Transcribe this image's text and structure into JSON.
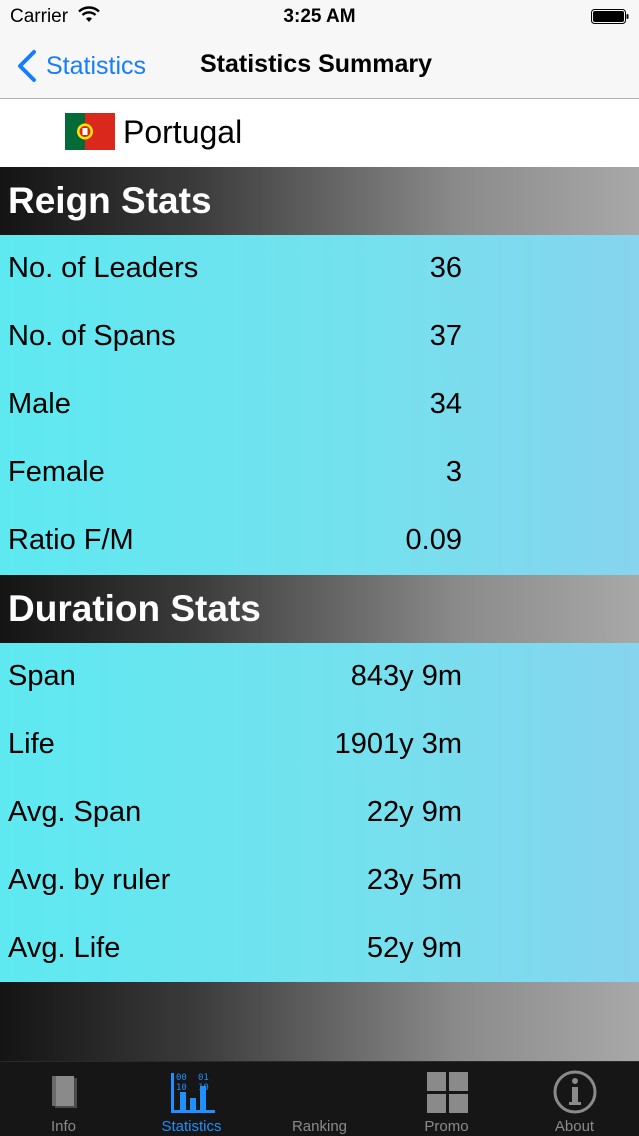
{
  "status_bar": {
    "carrier": "Carrier",
    "time": "3:25 AM"
  },
  "nav": {
    "back_label": "Statistics",
    "title": "Statistics Summary"
  },
  "country": {
    "name": "Portugal",
    "flag_icon": "portugal-flag-icon"
  },
  "reign_stats": {
    "header": "Reign Stats",
    "rows": [
      {
        "label": "No. of Leaders",
        "value": "36"
      },
      {
        "label": "No. of Spans",
        "value": "37"
      },
      {
        "label": "Male",
        "value": "34"
      },
      {
        "label": "Female",
        "value": "3"
      },
      {
        "label": "Ratio F/M",
        "value": "0.09"
      }
    ]
  },
  "duration_stats": {
    "header": "Duration Stats",
    "rows": [
      {
        "label": "Span",
        "value": "843y 9m"
      },
      {
        "label": "Life",
        "value": "1901y 3m"
      },
      {
        "label": "Avg. Span",
        "value": "22y 9m"
      },
      {
        "label": "Avg. by ruler",
        "value": "23y 5m"
      },
      {
        "label": "Avg. Life",
        "value": "52y 9m"
      }
    ]
  },
  "tabs": [
    {
      "label": "Info",
      "icon": "book-icon",
      "active": false
    },
    {
      "label": "Statistics",
      "icon": "statistics-icon",
      "active": true
    },
    {
      "label": "Ranking",
      "icon": "ranking-icon",
      "active": false
    },
    {
      "label": "Promo",
      "icon": "grid-icon",
      "active": false
    },
    {
      "label": "About",
      "icon": "info-icon",
      "active": false
    }
  ],
  "colors": {
    "accent": "#157efb",
    "active_tab": "#1e90ff",
    "stat_background": "#6ee4ef",
    "tabbar": "#161616"
  }
}
